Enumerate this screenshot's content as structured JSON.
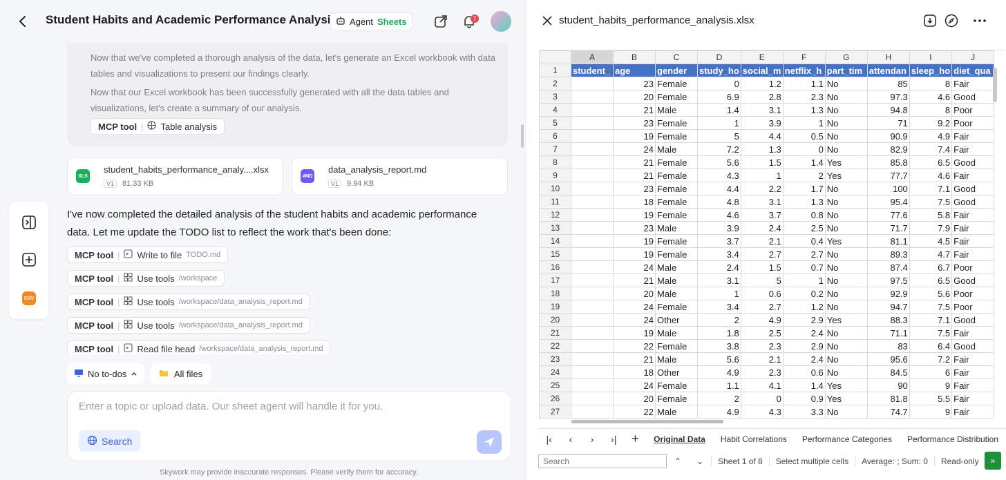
{
  "header": {
    "title": "Student Habits and Academic Performance Analysis",
    "agent_label": "Agent",
    "sheets_label": "Sheets",
    "notification_count": "7"
  },
  "thought": {
    "p1": "Now that we've completed a thorough analysis of the data, let's generate an Excel workbook with data tables and visualizations to present our findings clearly.",
    "p2": "Now that our Excel workbook has been successfully generated with all the data tables and visualizations, let's create a summary of our analysis."
  },
  "mcp_label": "MCP tool",
  "table_chip": {
    "label": "Table analysis"
  },
  "files": [
    {
      "badge": "XLS",
      "name": "student_habits_performance_analy....xlsx",
      "ver": "V1",
      "size": "81.33 KB",
      "color": "#1fae5b"
    },
    {
      "badge": "#MD",
      "name": "data_analysis_report.md",
      "ver": "V1",
      "size": "9.94 KB",
      "color": "#6a5cf5"
    }
  ],
  "sidedock": {
    "csv_label": "CSV"
  },
  "message": "I've now completed the detailed analysis of the student habits and academic performance data. Let me update the TODO list to reflect the work that's been done:",
  "tool_calls": [
    {
      "action": "Write to file",
      "path": "TODO.md"
    },
    {
      "action": "Use tools",
      "path": "/workspace"
    },
    {
      "action": "Use tools",
      "path": "/workspace/data_analysis_report.md"
    },
    {
      "action": "Use tools",
      "path": "/workspace/data_analysis_report.md"
    },
    {
      "action": "Read file head",
      "path": "/workspace/data_analysis_report.md"
    }
  ],
  "todos": {
    "label": "No to-dos"
  },
  "allfiles": {
    "label": "All files"
  },
  "input": {
    "placeholder": "Enter a topic or upload data. Our sheet agent will handle it for you.",
    "search_label": "Search"
  },
  "disclaimer": "Skywork may provide inaccurate responses. Please verify them for accuracy.",
  "right": {
    "filename": "student_habits_performance_analysis.xlsx"
  },
  "sheet": {
    "col_letters": [
      "A",
      "B",
      "C",
      "D",
      "E",
      "F",
      "G",
      "H",
      "I",
      "J"
    ],
    "headers": [
      "student_",
      "age",
      "gender",
      "study_ho",
      "social_m",
      "netflix_h",
      "part_tim",
      "attendan",
      "sleep_ho",
      "diet_qua"
    ],
    "rows": [
      [
        "",
        "23",
        "Female",
        "0",
        "1.2",
        "1.1",
        "No",
        "85",
        "8",
        "Fair"
      ],
      [
        "",
        "20",
        "Female",
        "6.9",
        "2.8",
        "2.3",
        "No",
        "97.3",
        "4.6",
        "Good"
      ],
      [
        "",
        "21",
        "Male",
        "1.4",
        "3.1",
        "1.3",
        "No",
        "94.8",
        "8",
        "Poor"
      ],
      [
        "",
        "23",
        "Female",
        "1",
        "3.9",
        "1",
        "No",
        "71",
        "9.2",
        "Poor"
      ],
      [
        "",
        "19",
        "Female",
        "5",
        "4.4",
        "0.5",
        "No",
        "90.9",
        "4.9",
        "Fair"
      ],
      [
        "",
        "24",
        "Male",
        "7.2",
        "1.3",
        "0",
        "No",
        "82.9",
        "7.4",
        "Fair"
      ],
      [
        "",
        "21",
        "Female",
        "5.6",
        "1.5",
        "1.4",
        "Yes",
        "85.8",
        "6.5",
        "Good"
      ],
      [
        "",
        "21",
        "Female",
        "4.3",
        "1",
        "2",
        "Yes",
        "77.7",
        "4.6",
        "Fair"
      ],
      [
        "",
        "23",
        "Female",
        "4.4",
        "2.2",
        "1.7",
        "No",
        "100",
        "7.1",
        "Good"
      ],
      [
        "",
        "18",
        "Female",
        "4.8",
        "3.1",
        "1.3",
        "No",
        "95.4",
        "7.5",
        "Good"
      ],
      [
        "",
        "19",
        "Female",
        "4.6",
        "3.7",
        "0.8",
        "No",
        "77.6",
        "5.8",
        "Fair"
      ],
      [
        "",
        "23",
        "Male",
        "3.9",
        "2.4",
        "2.5",
        "No",
        "71.7",
        "7.9",
        "Fair"
      ],
      [
        "",
        "19",
        "Female",
        "3.7",
        "2.1",
        "0.4",
        "Yes",
        "81.1",
        "4.5",
        "Fair"
      ],
      [
        "",
        "19",
        "Female",
        "3.4",
        "2.7",
        "2.7",
        "No",
        "89.3",
        "4.7",
        "Fair"
      ],
      [
        "",
        "24",
        "Male",
        "2.4",
        "1.5",
        "0.7",
        "No",
        "87.4",
        "6.7",
        "Poor"
      ],
      [
        "",
        "21",
        "Male",
        "3.1",
        "5",
        "1",
        "No",
        "97.5",
        "6.5",
        "Good"
      ],
      [
        "",
        "20",
        "Male",
        "1",
        "0.6",
        "0.2",
        "No",
        "92.9",
        "5.6",
        "Poor"
      ],
      [
        "",
        "24",
        "Female",
        "3.4",
        "2.7",
        "1.2",
        "No",
        "94.7",
        "7.5",
        "Poor"
      ],
      [
        "",
        "24",
        "Other",
        "2",
        "4.9",
        "2.9",
        "Yes",
        "88.3",
        "7.1",
        "Good"
      ],
      [
        "",
        "19",
        "Male",
        "1.8",
        "2.5",
        "2.4",
        "No",
        "71.1",
        "7.5",
        "Fair"
      ],
      [
        "",
        "22",
        "Female",
        "3.8",
        "2.3",
        "2.9",
        "No",
        "83",
        "6.4",
        "Good"
      ],
      [
        "",
        "21",
        "Male",
        "5.6",
        "2.1",
        "2.4",
        "No",
        "95.6",
        "7.2",
        "Fair"
      ],
      [
        "",
        "18",
        "Other",
        "4.9",
        "2.3",
        "0.6",
        "No",
        "84.5",
        "6",
        "Fair"
      ],
      [
        "",
        "24",
        "Female",
        "1.1",
        "4.1",
        "1.4",
        "Yes",
        "90",
        "9",
        "Fair"
      ],
      [
        "",
        "20",
        "Female",
        "2",
        "0",
        "0.9",
        "Yes",
        "81.8",
        "5.5",
        "Fair"
      ],
      [
        "",
        "22",
        "Male",
        "4.9",
        "4.3",
        "3.3",
        "No",
        "74.7",
        "9",
        "Fair"
      ]
    ]
  },
  "sheet_tabs": [
    "Original Data",
    "Habit Correlations",
    "Performance Categories",
    "Performance Distribution"
  ],
  "status": {
    "search_placeholder": "Search",
    "sheet_of": "Sheet 1 of 8",
    "select_mode": "Select multiple cells",
    "summary": "Average: ; Sum: 0",
    "readonly": "Read-only"
  }
}
